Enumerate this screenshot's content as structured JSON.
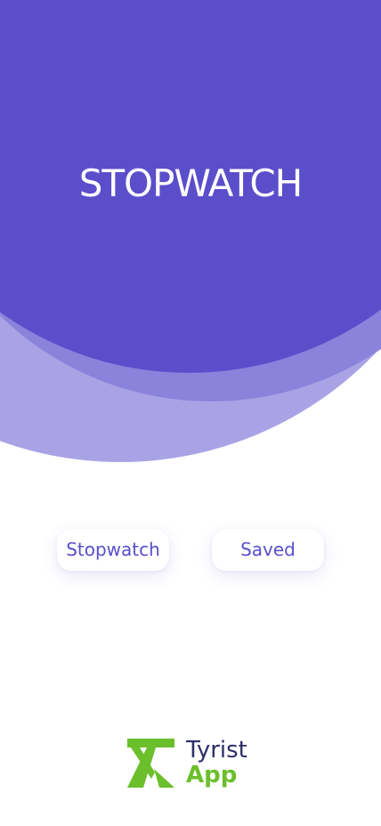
{
  "colors": {
    "primary": "#5b4ecb",
    "wave_light": "#a9a3e6",
    "wave_mid": "#8b82db",
    "wave_pale": "#dedcf6",
    "button_text": "#5a4ecb",
    "logo_navy": "#2e2f6b",
    "logo_green": "#6bbf2b"
  },
  "header": {
    "title": "STOPWATCH"
  },
  "nav": {
    "stopwatch_label": "Stopwatch",
    "saved_label": "Saved"
  },
  "brand": {
    "line1": "Tyrist",
    "line2": "App",
    "icon": "tyrist-logo-icon"
  }
}
